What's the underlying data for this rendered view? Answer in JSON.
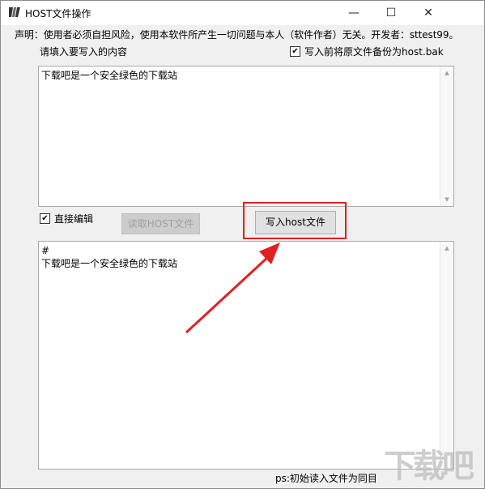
{
  "window": {
    "title": "HOST文件操作",
    "controls": {
      "minimize": "—",
      "maximize": "☐",
      "close": "✕"
    }
  },
  "statement": "声明：使用者必须自担风险，使用本软件所产生一切问题与本人（软件作者）无关。开发者：sttest99。",
  "input_prompt": "请填入要写入的内容",
  "backup_option": {
    "label": "写入前将原文件备份为host.bak",
    "checked": true
  },
  "top_textarea": {
    "content": "下载吧是一个安全绿色的下载站"
  },
  "direct_edit_option": {
    "label": "直接编辑",
    "checked": true
  },
  "buttons": {
    "read_host": "读取HOST文件",
    "write_host": "写入host文件"
  },
  "bottom_textarea": {
    "content": "#\n下载吧是一个安全绿色的下载站"
  },
  "footer_note": "ps:初始读入文件为同目",
  "watermark": "下载吧",
  "colors": {
    "highlight": "#e02020",
    "window_bg": "#f0f0f0",
    "disabled_button": "#cccccc"
  },
  "icons": {
    "app": "app-logo-icon",
    "scroll_up": "scroll-up-icon",
    "scroll_down": "scroll-down-icon",
    "check": "checkmark-icon"
  }
}
